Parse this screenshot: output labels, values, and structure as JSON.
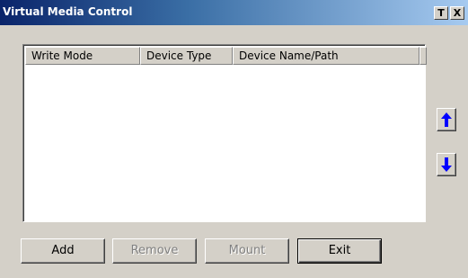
{
  "window": {
    "title": "Virtual Media Control",
    "pin_label": "T",
    "close_label": "X"
  },
  "list": {
    "columns": [
      "Write Mode",
      "Device Type",
      "Device Name/Path"
    ],
    "rows": []
  },
  "side_buttons": {
    "up_icon": "arrow-up-icon",
    "down_icon": "arrow-down-icon",
    "arrow_color": "#0000ff"
  },
  "buttons": {
    "add": "Add",
    "remove": "Remove",
    "mount": "Mount",
    "exit": "Exit"
  }
}
